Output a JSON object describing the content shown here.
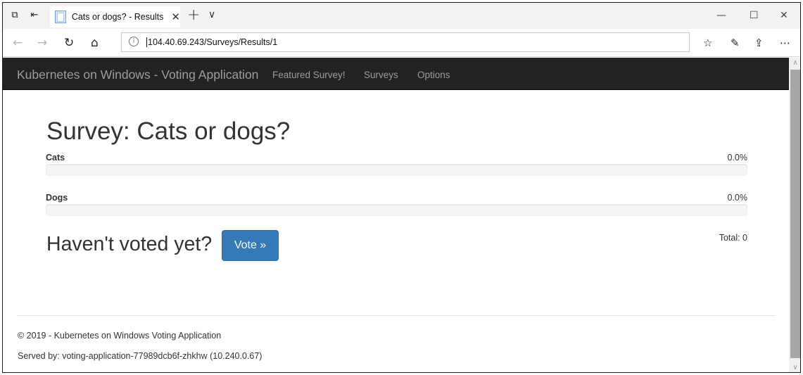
{
  "browser": {
    "tab_title": "Cats or dogs? - Results",
    "url": "104.40.69.243/Surveys/Results/1",
    "icons": {
      "tab_actions": "tab-actions-icon",
      "set_aside": "set-aside-tabs-icon",
      "back": "back-arrow-icon",
      "forward": "forward-arrow-icon",
      "refresh": "refresh-icon",
      "home": "home-icon",
      "info": "info-icon",
      "favorites": "favorites-icon",
      "pen": "pen-icon",
      "share": "share-icon",
      "more": "more-icon",
      "new_tab": "plus-icon",
      "tab_list": "chevron-down-icon",
      "minimize": "minimize-icon",
      "maximize": "maximize-icon",
      "close": "close-icon"
    }
  },
  "navbar": {
    "brand": "Kubernetes on Windows - Voting Application",
    "links": [
      "Featured Survey!",
      "Surveys",
      "Options"
    ]
  },
  "survey": {
    "title": "Survey: Cats or dogs?",
    "options": [
      {
        "label": "Cats",
        "percent_text": "0.0%",
        "percent": 0.0
      },
      {
        "label": "Dogs",
        "percent_text": "0.0%",
        "percent": 0.0
      }
    ],
    "cta_text": "Haven't voted yet?",
    "vote_button": "Vote »",
    "total": "Total: 0"
  },
  "footer": {
    "copyright": "© 2019 - Kubernetes on Windows Voting Application",
    "served_by": "Served by: voting-application-77989dcb6f-zhkhw (10.240.0.67)"
  },
  "colors": {
    "navbar_bg": "#222222",
    "navbar_text": "#9d9d9d",
    "primary": "#337ab7",
    "progress_bg": "#f5f5f5"
  }
}
